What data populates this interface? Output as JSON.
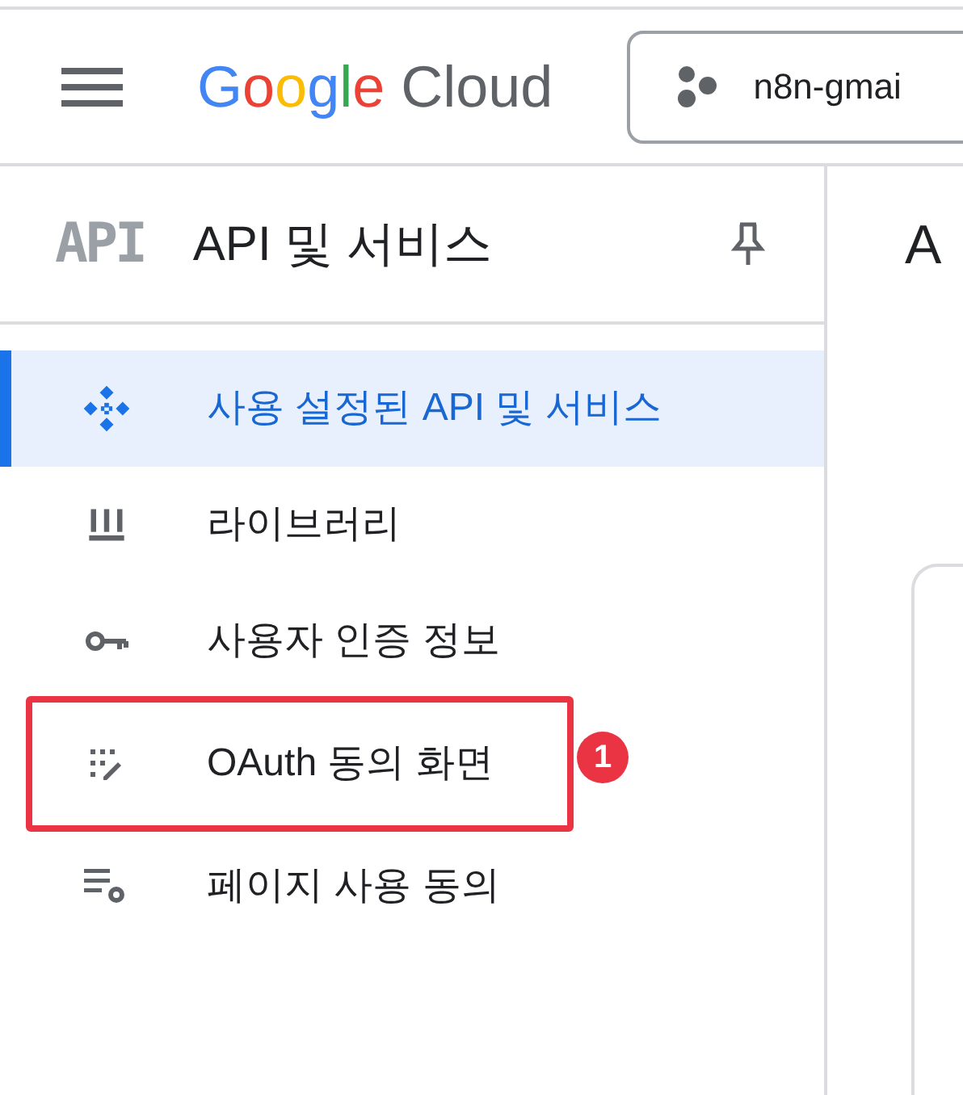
{
  "header": {
    "logo": {
      "brand": "Google",
      "product": "Cloud"
    },
    "project_selector": {
      "label": "n8n-gmai"
    }
  },
  "sidebar": {
    "logo_text": "API",
    "title": "API 및 서비스",
    "items": [
      {
        "label": "사용 설정된 API 및 서비스",
        "kind": "diamond",
        "selected": true,
        "annotated": false
      },
      {
        "label": "라이브러리",
        "kind": "library",
        "selected": false,
        "annotated": false
      },
      {
        "label": "사용자 인증 정보",
        "kind": "key",
        "selected": false,
        "annotated": false
      },
      {
        "label": "OAuth 동의 화면",
        "kind": "consent",
        "selected": false,
        "annotated": true
      },
      {
        "label": "페이지 사용 동의",
        "kind": "settings",
        "selected": false,
        "annotated": false
      }
    ]
  },
  "annotation": {
    "badge": "1"
  },
  "main": {
    "title": "A"
  }
}
